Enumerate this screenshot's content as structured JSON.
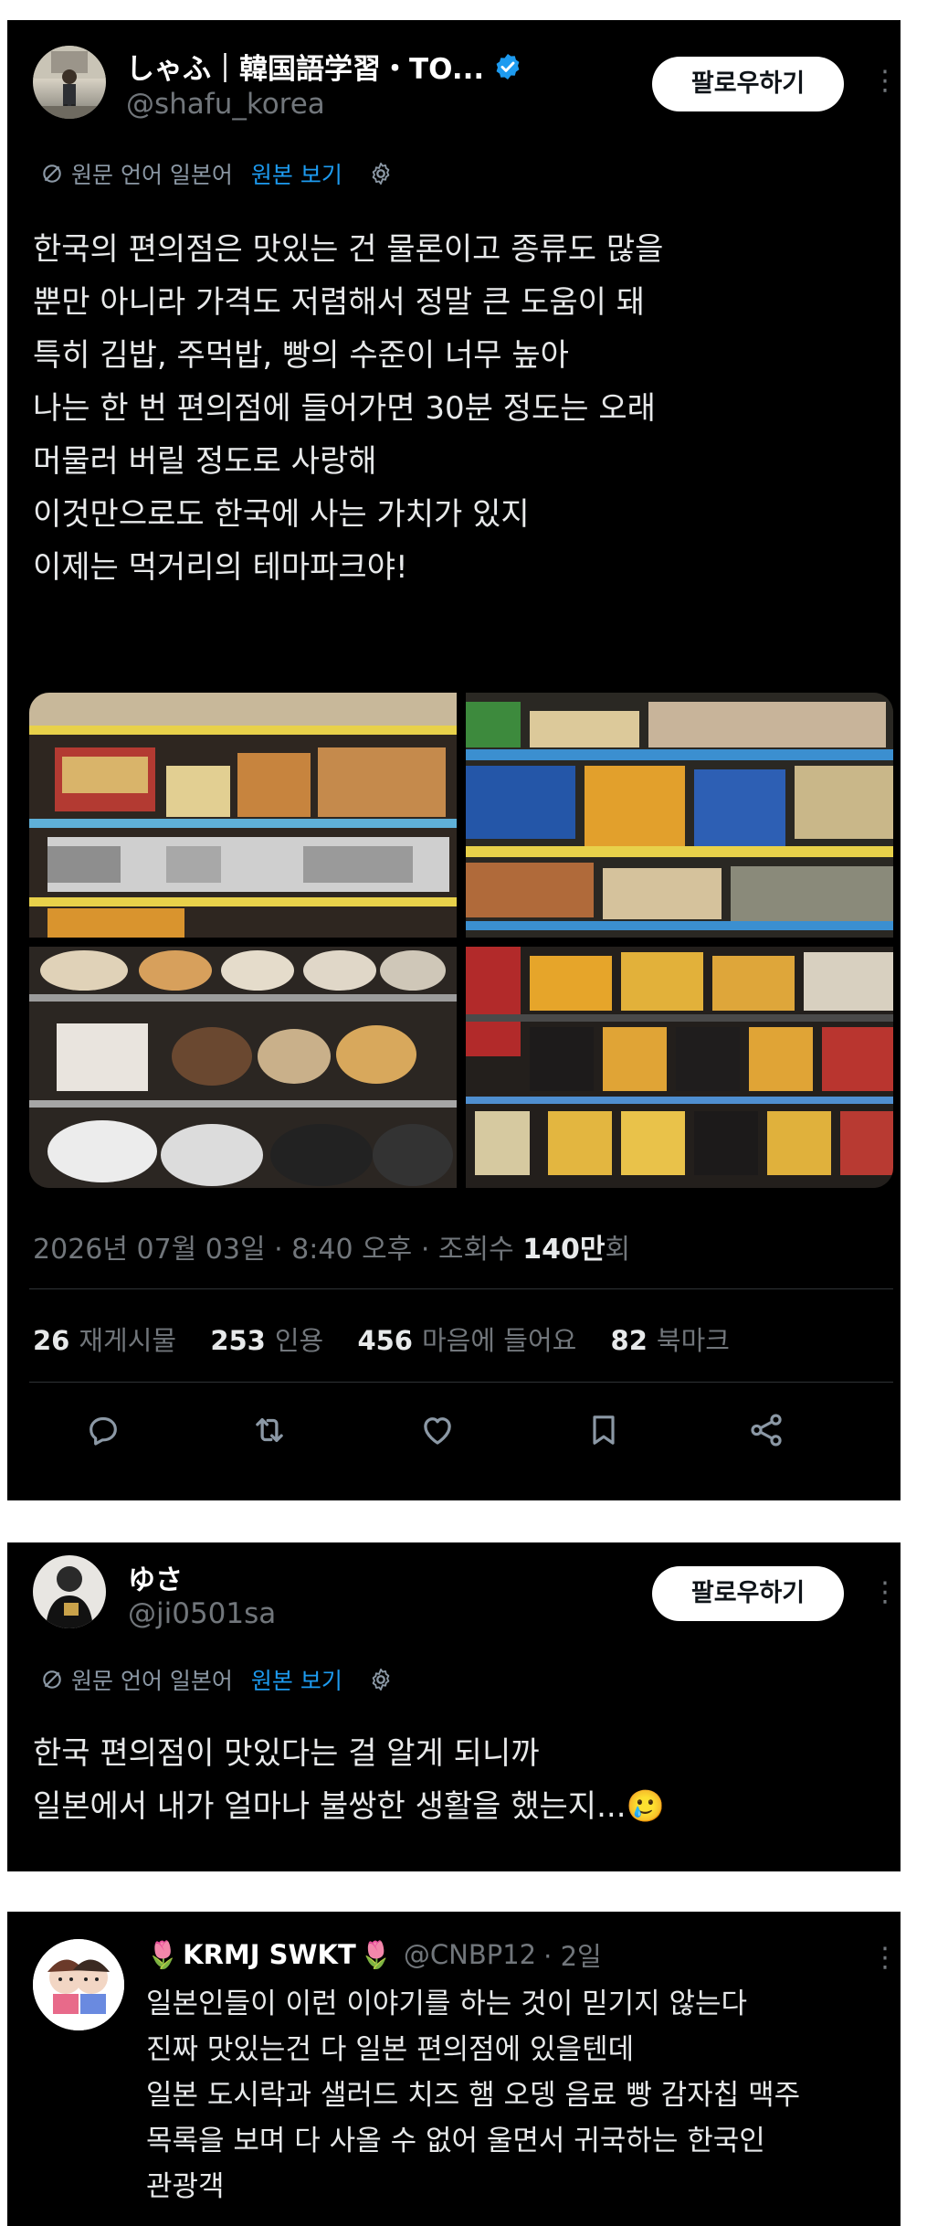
{
  "tweet": {
    "display_name": "しゃふ｜韓国語学習・TO...",
    "handle": "@shafu_korea",
    "follow_label": "팔로우하기",
    "translate": {
      "source_label": "원문 언어 일본어",
      "link_label": "원본 보기"
    },
    "text_lines": [
      "한국의 편의점은 맛있는 건 물론이고 종류도 많을",
      "뿐만 아니라 가격도 저렴해서 정말 큰 도움이 돼",
      "특히 김밥, 주먹밥, 빵의 수준이 너무 높아",
      "나는 한 번 편의점에 들어가면 30분 정도는 오래",
      "머물러 버릴 정도로 사랑해",
      "이것만으로도 한국에 사는 가치가 있지",
      "이제는 먹거리의 테마파크야!"
    ],
    "timestamp": "2026년 07월 03일 · 8:40 오후 · 조회수 ",
    "views_value": "140만",
    "views_suffix": "회",
    "stats": {
      "retweets_count": "26",
      "retweets_label": "재게시물",
      "quotes_count": "253",
      "quotes_label": "인용",
      "likes_count": "456",
      "likes_label": "마음에 들어요",
      "bookmarks_count": "82",
      "bookmarks_label": "북마크"
    },
    "icons": [
      "reply-icon",
      "retweet-icon",
      "like-icon",
      "bookmark-icon",
      "share-icon"
    ]
  },
  "reply1": {
    "display_name": "ゆさ",
    "handle": "@ji0501sa",
    "follow_label": "팔로우하기",
    "translate": {
      "source_label": "원문 언어 일본어",
      "link_label": "원본 보기"
    },
    "text_lines": [
      "한국 편의점이 맛있다는 걸 알게 되니까",
      "일본에서 내가 얼마나 불쌍한 생활을 했는지..."
    ],
    "emoji": "🥲"
  },
  "reply2": {
    "display_name": "KRMJ SWKT",
    "handle": "@CNBP12",
    "time": "· 2일",
    "name_emoji": "🌷",
    "text_lines": [
      "일본인들이 이런 이야기를 하는 것이 믿기지 않는다",
      "진짜 맛있는건 다 일본 편의점에 있을텐데",
      "일본 도시락과 샐러드 치즈 햄 오뎅 음료 빵 감자칩 맥주",
      "목록을 보며 다 사올 수 없어 울면서 귀국하는 한국인",
      "관광객"
    ]
  },
  "colors": {
    "background": "#000000",
    "text": "#e7e9ea",
    "secondary": "#71767b",
    "link": "#1d9bf0",
    "verified": "#1d9bf0",
    "page": "#ffffff"
  }
}
